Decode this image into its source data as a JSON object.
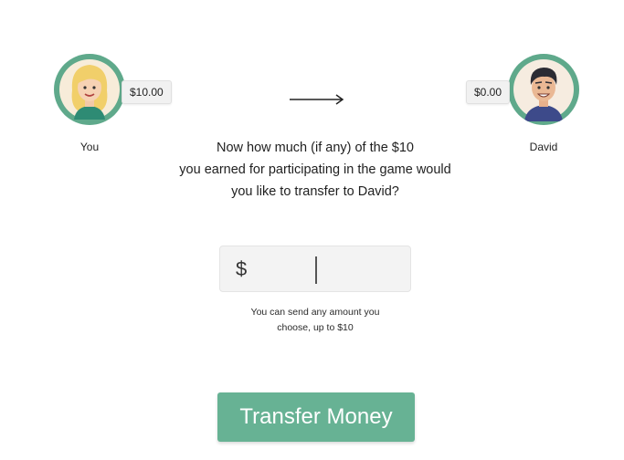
{
  "participants": {
    "you": {
      "name": "You",
      "balance": "$10.00",
      "avatar_icon": "female-avatar-icon"
    },
    "david": {
      "name": "David",
      "balance": "$0.00",
      "avatar_icon": "male-avatar-icon"
    }
  },
  "question": {
    "line1": "Now how much (if any) of the $10",
    "line2": "you earned for participating in the game would",
    "line3": "you like to transfer to David?"
  },
  "amount": {
    "currency_symbol": "$",
    "value": ""
  },
  "hint": {
    "line1": "You can send any amount you",
    "line2": "choose, up to $10"
  },
  "transfer_button_label": "Transfer Money",
  "colors": {
    "accent": "#67b294",
    "avatar_ring": "#5fa98b"
  }
}
